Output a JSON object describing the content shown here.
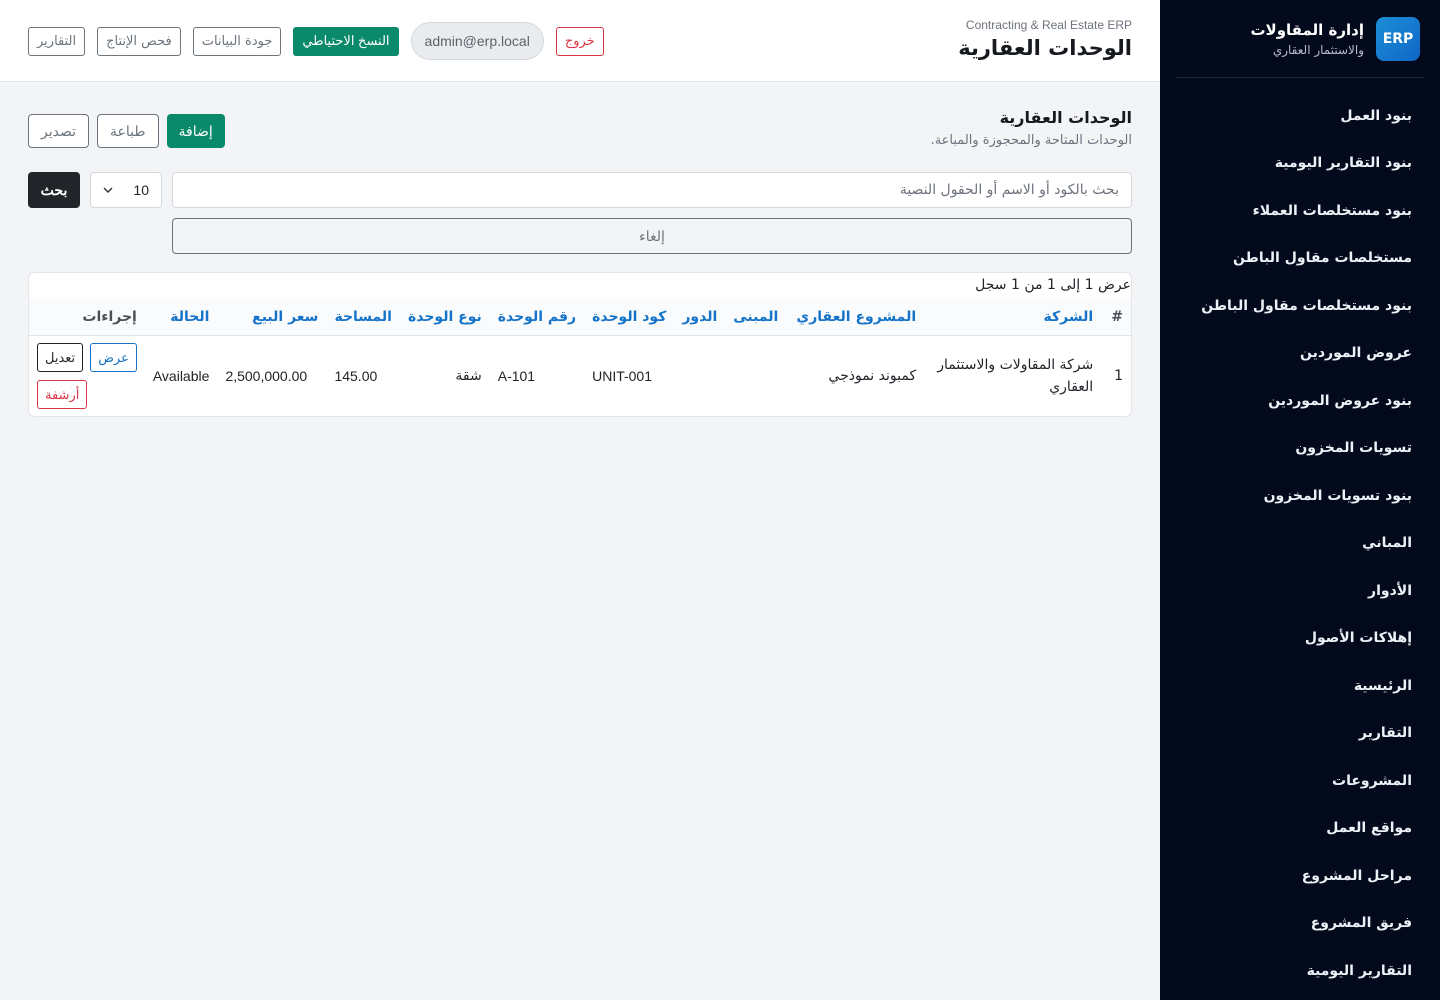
{
  "sidebar": {
    "brand_logo": "ERP",
    "brand_title": "إدارة المقاولات",
    "brand_subtitle": "والاستثمار العقاري",
    "items": [
      {
        "label": "بنود العمل"
      },
      {
        "label": "بنود التقارير اليومية"
      },
      {
        "label": "بنود مستخلصات العملاء"
      },
      {
        "label": "مستخلصات مقاول الباطن"
      },
      {
        "label": "بنود مستخلصات مقاول الباطن"
      },
      {
        "label": "عروض الموردين"
      },
      {
        "label": "بنود عروض الموردين"
      },
      {
        "label": "تسويات المخزون"
      },
      {
        "label": "بنود تسويات المخزون"
      },
      {
        "label": "المباني"
      },
      {
        "label": "الأدوار"
      },
      {
        "label": "إهلاكات الأصول"
      },
      {
        "label": "الرئيسية"
      },
      {
        "label": "التقارير"
      },
      {
        "label": "المشروعات"
      },
      {
        "label": "مواقع العمل"
      },
      {
        "label": "مراحل المشروع"
      },
      {
        "label": "فريق المشروع"
      },
      {
        "label": "التقارير اليومية"
      }
    ]
  },
  "topbar": {
    "subtitle": "Contracting & Real Estate ERP",
    "title": "الوحدات العقارية",
    "reports_label": "التقارير",
    "production_check_label": "فحص الإنتاج",
    "data_quality_label": "جودة البيانات",
    "backup_label": "النسخ الاحتياطي",
    "user_email": "admin@erp.local",
    "logout_label": "خروج"
  },
  "section": {
    "title": "الوحدات العقارية",
    "description": "الوحدات المتاحة والمحجوزة والمباعة.",
    "add_label": "إضافة",
    "print_label": "طباعة",
    "export_label": "تصدير"
  },
  "search": {
    "placeholder": "بحث بالكود أو الاسم أو الحقول النصية",
    "page_size": "10",
    "search_label": "بحث",
    "cancel_label": "إلغاء"
  },
  "table": {
    "records_info": "عرض 1 إلى 1 من 1 سجل",
    "headers": {
      "index": "#",
      "company": "الشركة",
      "project": "المشروع العقاري",
      "building": "المبنى",
      "floor": "الدور",
      "unit_code": "كود الوحدة",
      "unit_number": "رقم الوحدة",
      "unit_type": "نوع الوحدة",
      "area": "المساحة",
      "sale_price": "سعر البيع",
      "status": "الحالة",
      "actions": "إجراءات"
    },
    "rows": [
      {
        "index": "1",
        "company": "شركة المقاولات والاستثمار العقاري",
        "project": "كمبوند نموذجي",
        "building": "",
        "floor": "",
        "unit_code": "UNIT-001",
        "unit_number": "A-101",
        "unit_type": "شقة",
        "area": "145.00",
        "sale_price": "2,500,000.00",
        "status": "Available",
        "view_label": "عرض",
        "edit_label": "تعديل",
        "archive_label": "أرشفة"
      }
    ]
  },
  "colors": {
    "sidebar_bg": "#030a1c",
    "primary_green": "#0b8a6b",
    "link_blue": "#1574c9",
    "danger_red": "#dc3545"
  }
}
